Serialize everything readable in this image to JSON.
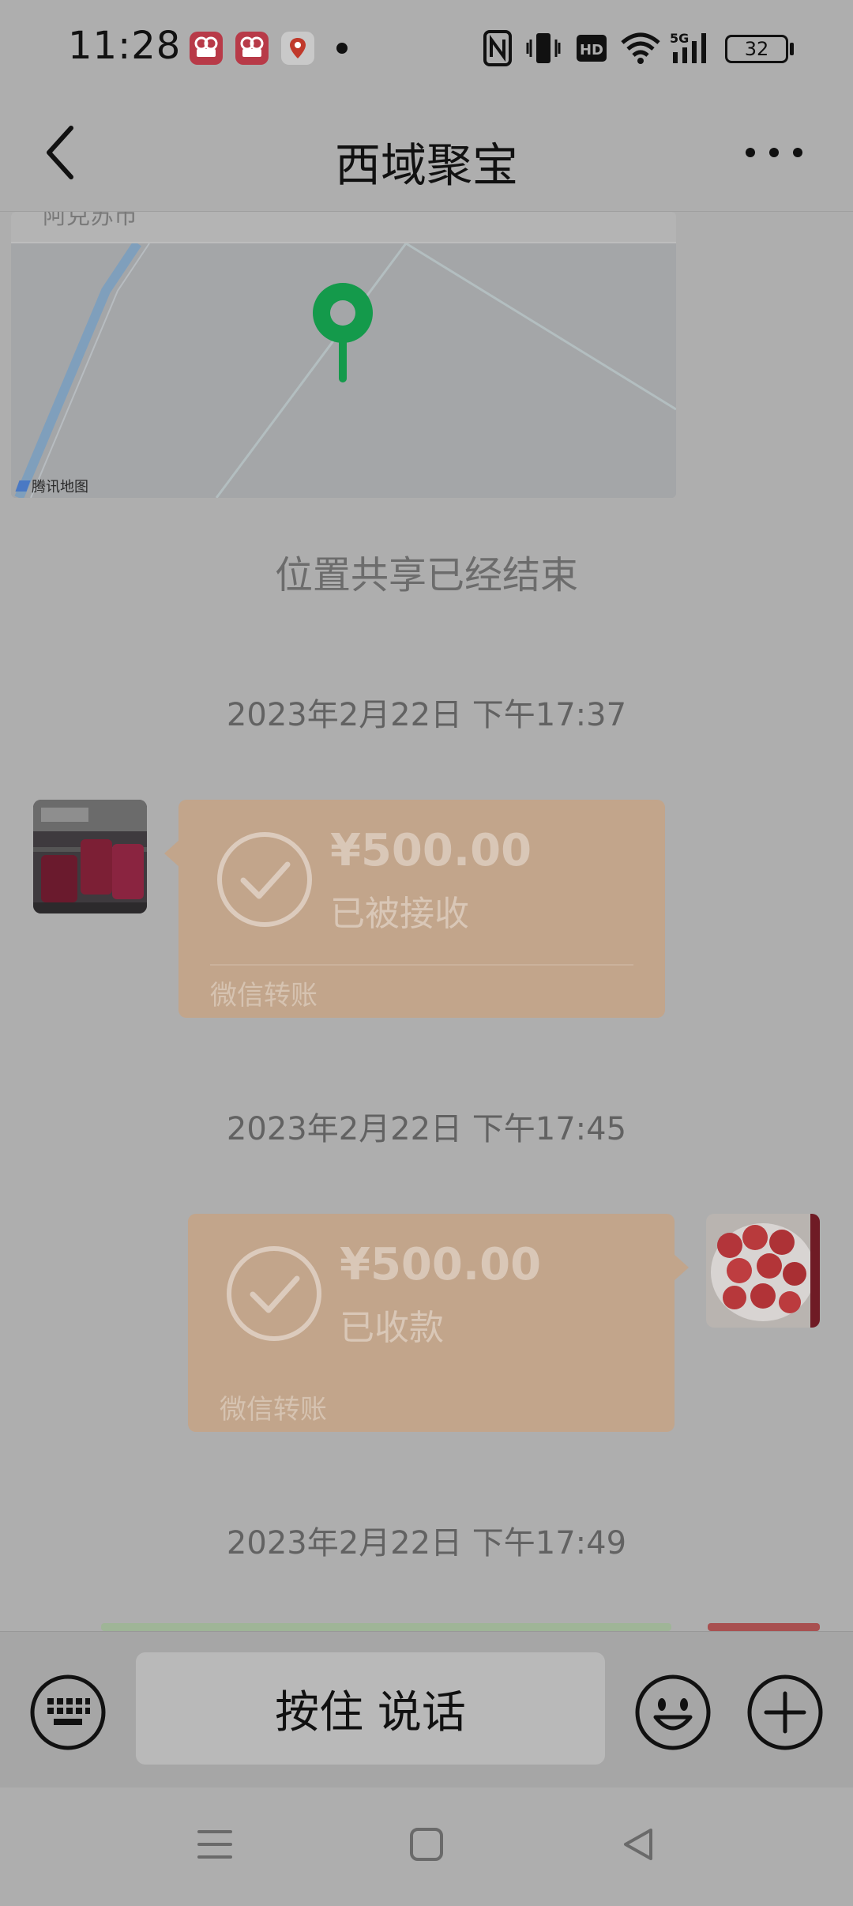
{
  "status_bar": {
    "time": "11:28",
    "battery": "32",
    "icons": [
      "app-icon-video-1",
      "app-icon-video-2",
      "app-icon-location",
      "nfc-icon",
      "vibrate-icon",
      "hd-icon",
      "wifi-icon",
      "signal-5g-icon",
      "battery-icon"
    ]
  },
  "header": {
    "title": "西域聚宝",
    "back_icon": "chevron-left-icon",
    "more_icon": "more-dots-icon"
  },
  "messages": {
    "map": {
      "top_text": "阿克苏市",
      "attribution": "腾讯地图"
    },
    "location_ended": "位置共享已经结束",
    "timestamp_1": "2023年2月22日 下午17:37",
    "transfer_1": {
      "amount": "¥500.00",
      "status": "已被接收",
      "type": "微信转账"
    },
    "timestamp_2": "2023年2月22日 下午17:45",
    "transfer_2": {
      "amount": "¥500.00",
      "status": "已收款",
      "type": "微信转账"
    },
    "timestamp_3": "2023年2月22日 下午17:49"
  },
  "input_bar": {
    "hold_to_talk": "按住 说话",
    "keyboard_icon": "keyboard-icon",
    "emoji_icon": "emoji-icon",
    "plus_icon": "plus-icon"
  },
  "nav_bar": {
    "icons": [
      "menu-icon",
      "home-icon",
      "back-icon"
    ]
  },
  "colors": {
    "overlay_background": "#aeaeae",
    "transfer_card": "#c2a58b",
    "map_pin": "#149a4b"
  }
}
